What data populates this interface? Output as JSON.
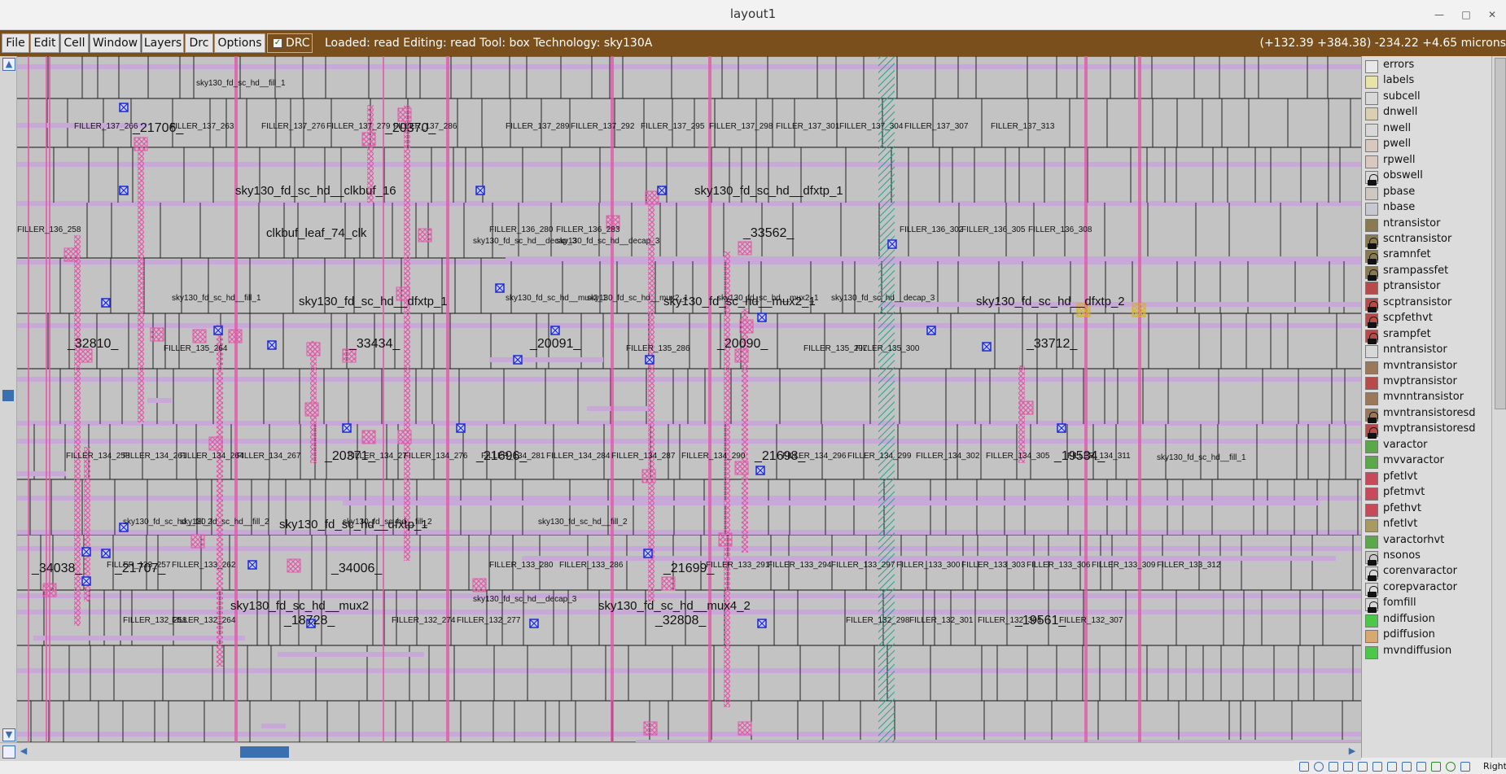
{
  "window": {
    "title": "layout1"
  },
  "menu": {
    "file": "File",
    "edit": "Edit",
    "cell": "Cell",
    "window": "Window",
    "layers": "Layers",
    "drc_menu": "Drc",
    "options": "Options",
    "drc_toggle": "DRC"
  },
  "status": {
    "text": "Loaded: read Editing: read Tool: box  Technology: sky130A",
    "coords": "(+132.39 +384.38) -234.22 +4.65 microns"
  },
  "colors": {
    "menubar": "#7b4f1c",
    "canvas": "#c3c3c3",
    "metal1": "#c8a8d8",
    "poly_contact": "#e05aa8",
    "via": "#1e2ad0",
    "hatch": "#2aa08a"
  },
  "layers": [
    {
      "name": "errors",
      "color": "#e8e8e8",
      "locked": false
    },
    {
      "name": "labels",
      "color": "#e8e4a8",
      "locked": false
    },
    {
      "name": "subcell",
      "color": "#d8d8d8",
      "locked": false
    },
    {
      "name": "dnwell",
      "color": "#d8d0b0",
      "locked": false
    },
    {
      "name": "nwell",
      "color": "#d8d8d8",
      "locked": false
    },
    {
      "name": "pwell",
      "color": "#d8c8c0",
      "locked": false
    },
    {
      "name": "rpwell",
      "color": "#d8c8c0",
      "locked": false
    },
    {
      "name": "obswell",
      "color": "#d8d8d8",
      "locked": true
    },
    {
      "name": "pbase",
      "color": "#d0c8c0",
      "locked": false
    },
    {
      "name": "nbase",
      "color": "#c8c8d0",
      "locked": false
    },
    {
      "name": "ntransistor",
      "color": "#8a7a50",
      "locked": false
    },
    {
      "name": "scntransistor",
      "color": "#8a7a50",
      "locked": true
    },
    {
      "name": "sramnfet",
      "color": "#8a7a50",
      "locked": true
    },
    {
      "name": "srampassfet",
      "color": "#8a7a50",
      "locked": true
    },
    {
      "name": "ptransistor",
      "color": "#b84a4a",
      "locked": false
    },
    {
      "name": "scptransistor",
      "color": "#b84a4a",
      "locked": true
    },
    {
      "name": "scpfethvt",
      "color": "#b84a4a",
      "locked": true
    },
    {
      "name": "srampfet",
      "color": "#b84a4a",
      "locked": true
    },
    {
      "name": "nntransistor",
      "color": "#d8d8d8",
      "locked": false
    },
    {
      "name": "mvntransistor",
      "color": "#9a7858",
      "locked": false
    },
    {
      "name": "mvptransistor",
      "color": "#b84a4a",
      "locked": false
    },
    {
      "name": "mvnntransistor",
      "color": "#9a7858",
      "locked": false
    },
    {
      "name": "mvntransistoresd",
      "color": "#9a7858",
      "locked": true
    },
    {
      "name": "mvptransistoresd",
      "color": "#b84a4a",
      "locked": true
    },
    {
      "name": "varactor",
      "color": "#5aa84a",
      "locked": false
    },
    {
      "name": "mvvaractor",
      "color": "#5aa84a",
      "locked": false
    },
    {
      "name": "pfetlvt",
      "color": "#c84a5a",
      "locked": false
    },
    {
      "name": "pfetmvt",
      "color": "#c84a5a",
      "locked": false
    },
    {
      "name": "pfethvt",
      "color": "#c84a5a",
      "locked": false
    },
    {
      "name": "nfetlvt",
      "color": "#a89a60",
      "locked": false
    },
    {
      "name": "varactorhvt",
      "color": "#5aa84a",
      "locked": false
    },
    {
      "name": "nsonos",
      "color": "#c8c8c8",
      "locked": true
    },
    {
      "name": "corenvaractor",
      "color": "#d8d8d8",
      "locked": true
    },
    {
      "name": "corepvaractor",
      "color": "#d8d8d8",
      "locked": true
    },
    {
      "name": "fomfill",
      "color": "#d8d8d8",
      "locked": true
    },
    {
      "name": "ndiffusion",
      "color": "#4ac84a",
      "locked": false
    },
    {
      "name": "pdiffusion",
      "color": "#d8a870",
      "locked": false
    },
    {
      "name": "mvndiffusion",
      "color": "#4ac84a",
      "locked": false
    }
  ],
  "layout": {
    "big_labels": [
      "_21706_",
      "_20370_",
      "sky130_fd_sc_hd__clkbuf_16",
      "sky130_fd_sc_hd__dfxtp_1",
      "clkbuf_leaf_74_clk",
      "_33562_",
      "sky130_fd_sc_hd__dfxtp_1",
      "sky130_fd_sc_hd__mux2_1",
      "sky130_fd_sc_hd__dfxtp_2",
      "_32810_",
      "_33434_",
      "_20091_",
      "_20090_",
      "_33712_",
      "_20371_",
      "_21696_",
      "_21698_",
      "_19534_",
      "sky130_fd_sc_hd__dfxtp_1",
      "_34038_",
      "_21707_",
      "_34006_",
      "_21699_",
      "sky130_fd_sc_hd__mux2",
      "_18728_",
      "sky130_fd_sc_hd__mux4_2",
      "_32808_",
      "_19561_"
    ],
    "small_labels": [
      "FILLER_137_266",
      "FILLER_137_263",
      "FILLER_137_276",
      "FILLER_137_279",
      "FILLER_137_286",
      "FILLER_137_289",
      "FILLER_137_292",
      "FILLER_137_295",
      "FILLER_137_298",
      "FILLER_137_301",
      "FILLER_137_304",
      "FILLER_137_307",
      "FILLER_137_313",
      "FILLER_136_258",
      "FILLER_136_280",
      "FILLER_136_283",
      "FILLER_136_302",
      "FILLER_136_305",
      "FILLER_136_308",
      "FILLER_135_264",
      "FILLER_135_286",
      "FILLER_135_297",
      "FILLER_135_300",
      "sky130_fd_sc_hd__decap_3",
      "sky130_fd_sc_hd__decap_3",
      "FILLER_134_258",
      "FILLER_134_261",
      "FILLER_134_264",
      "FILLER_134_267",
      "FILLER_134_27",
      "FILLER_134_276",
      "FILLER_134_281",
      "FILLER_134_284",
      "FILLER_134_287",
      "FILLER_134_290",
      "FILLER_134_296",
      "FILLER_134_299",
      "FILLER_134_302",
      "FILLER_134_305",
      "FILLER_134_311",
      "FILLER_133_257",
      "FILLER_133_262",
      "FILLER_133_280",
      "FILLER_133_286",
      "FILLER_133_291",
      "FILLER_133_294",
      "FILLER_133_297",
      "FILLER_133_300",
      "FILLER_133_303",
      "FILLER_133_306",
      "FILLER_133_309",
      "FILLER_133_312",
      "FILLER_132_258",
      "FILLER_132_264",
      "FILLER_132_274",
      "FILLER_132_277",
      "FILLER_132_298",
      "FILLER_132_301",
      "FILLER_132_304",
      "FILLER_132_307",
      "sky130_fd_sc_hd__decap_3",
      "sky130_fd_sc_hd__fill_2",
      "sky130_fd_sc_hd__fill_1",
      "sky130_fd_sc_hd__decap_3",
      "sky130_fd_sc_hd__mux2_1",
      "sky130_fd_sc_hd__fill_2",
      "sky130_fd_sc_hd__fill_2",
      "sky130_fd_sc_hd__mux2_1",
      "sky130_fd_sc_hd__mux2_1",
      "sky130_fd_sc_hd__fill_2",
      "sky130_fd_sc_hd__fill_1",
      "sky130_fd_sc_hd__fill_1"
    ]
  },
  "toolbar_bottom": {
    "right_click": "Right Cl"
  }
}
